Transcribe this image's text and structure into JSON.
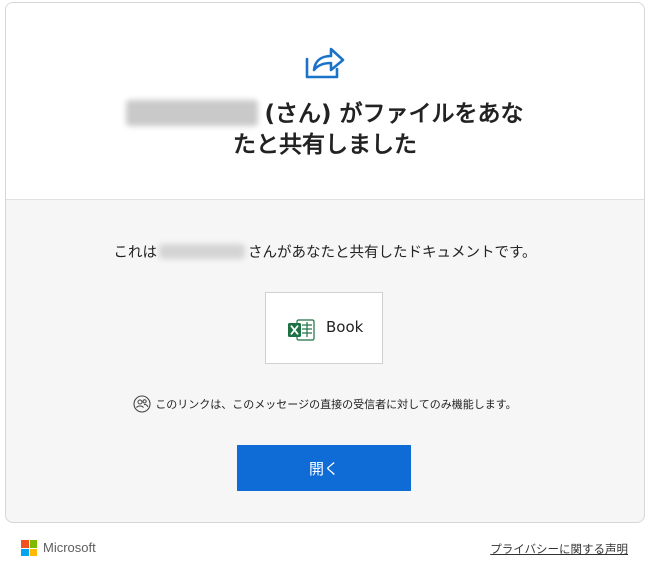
{
  "header": {
    "title_suffix_line1": "(さん) がファイルをあな",
    "title_line2": "たと共有しました"
  },
  "message": {
    "prefix": "これは",
    "suffix": "さんがあなたと共有したドキュメントです。"
  },
  "file": {
    "name": "Book",
    "icon": "excel-icon"
  },
  "notice": {
    "text": "このリンクは、このメッセージの直接の受信者に対してのみ機能します。",
    "icon": "recipients-icon"
  },
  "open_button": {
    "label": "開く"
  },
  "footer": {
    "brand": "Microsoft",
    "privacy_link": "プライバシーに関する声明"
  },
  "colors": {
    "accent": "#0f6cd6",
    "share_icon": "#1a73c9",
    "excel_green": "#1e7145",
    "ms_red": "#f25022",
    "ms_green": "#7fba00",
    "ms_blue": "#00a4ef",
    "ms_yellow": "#ffb900"
  }
}
